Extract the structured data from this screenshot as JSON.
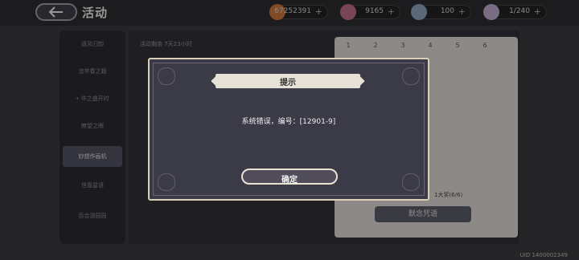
{
  "header": {
    "title": "活动",
    "resources": [
      {
        "icon": "coin-icon",
        "value": "67252391",
        "plus": "+",
        "color": "#c8743a"
      },
      {
        "icon": "star-gem-icon",
        "value": "9165",
        "plus": "+",
        "color": "#b86a86"
      },
      {
        "icon": "orb-icon",
        "value": "100",
        "plus": "+",
        "color": "#8aa0b8"
      },
      {
        "icon": "lightning-icon",
        "value": "1/240",
        "plus": "+",
        "color": "#b8a8c8"
      }
    ]
  },
  "sidebar": {
    "items": [
      {
        "label": "遗风归韵"
      },
      {
        "label": "流年春之籍"
      },
      {
        "label": "• 华之盛开时"
      },
      {
        "label": "瞭望之眼"
      },
      {
        "label": "妙想作画机",
        "active": true
      },
      {
        "label": "世嘉星语"
      },
      {
        "label": "百合游园园"
      }
    ]
  },
  "background": {
    "timer": "活动剩余 7天23小时",
    "tabs": [
      "1",
      "2",
      "3",
      "4",
      "5",
      "6"
    ],
    "reward_label": "1大奖(6/6)",
    "bottom_button": "默念咒语"
  },
  "footer": {
    "uid": "UID 1400002349"
  },
  "dialog": {
    "title": "提示",
    "message": "系统错误，编号：[12901-9]",
    "ok_label": "确定"
  }
}
